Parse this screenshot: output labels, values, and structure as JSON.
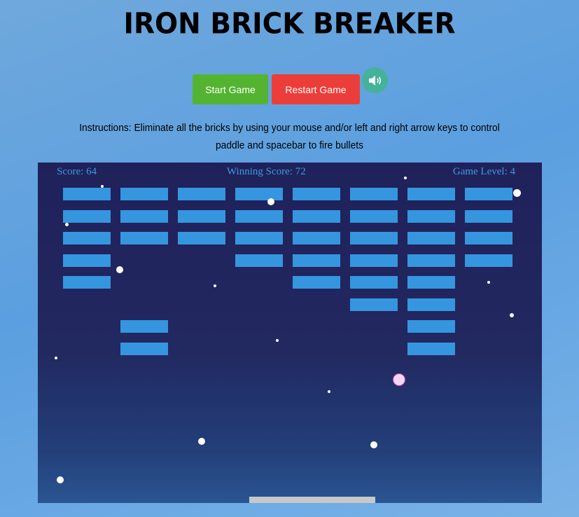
{
  "page": {
    "title": "IRON BRICK BREAKER",
    "instructions": "Instructions: Eliminate all the bricks by using your mouse and/or left and right arrow keys to control paddle and spacebar to fire bullets"
  },
  "controls": {
    "start_label": "Start Game",
    "restart_label": "Restart Game",
    "sound_icon": "speaker-sound-on-icon",
    "colors": {
      "start": "#54b431",
      "restart": "#eb3e3a",
      "sound": "#45b29a"
    }
  },
  "hud": {
    "score": "Score: 64",
    "winning_score": "Winning Score: 72",
    "level": "Game Level: 4"
  },
  "game": {
    "brick_color": "#3596df",
    "ball_color": "#f2d9f0",
    "paddle_color": "#c8c8c8",
    "brick_columns": [
      [
        1,
        1,
        1,
        1,
        1,
        0,
        0,
        0
      ],
      [
        1,
        1,
        1,
        0,
        0,
        0,
        1,
        1
      ],
      [
        1,
        1,
        1,
        0,
        0,
        0,
        0,
        0
      ],
      [
        1,
        1,
        1,
        1,
        0,
        0,
        0,
        0
      ],
      [
        1,
        1,
        1,
        1,
        1,
        0,
        0,
        0
      ],
      [
        1,
        1,
        1,
        1,
        1,
        1,
        0,
        0
      ],
      [
        1,
        1,
        1,
        1,
        1,
        1,
        1,
        1
      ],
      [
        1,
        1,
        1,
        1,
        0,
        0,
        0,
        0
      ]
    ]
  }
}
